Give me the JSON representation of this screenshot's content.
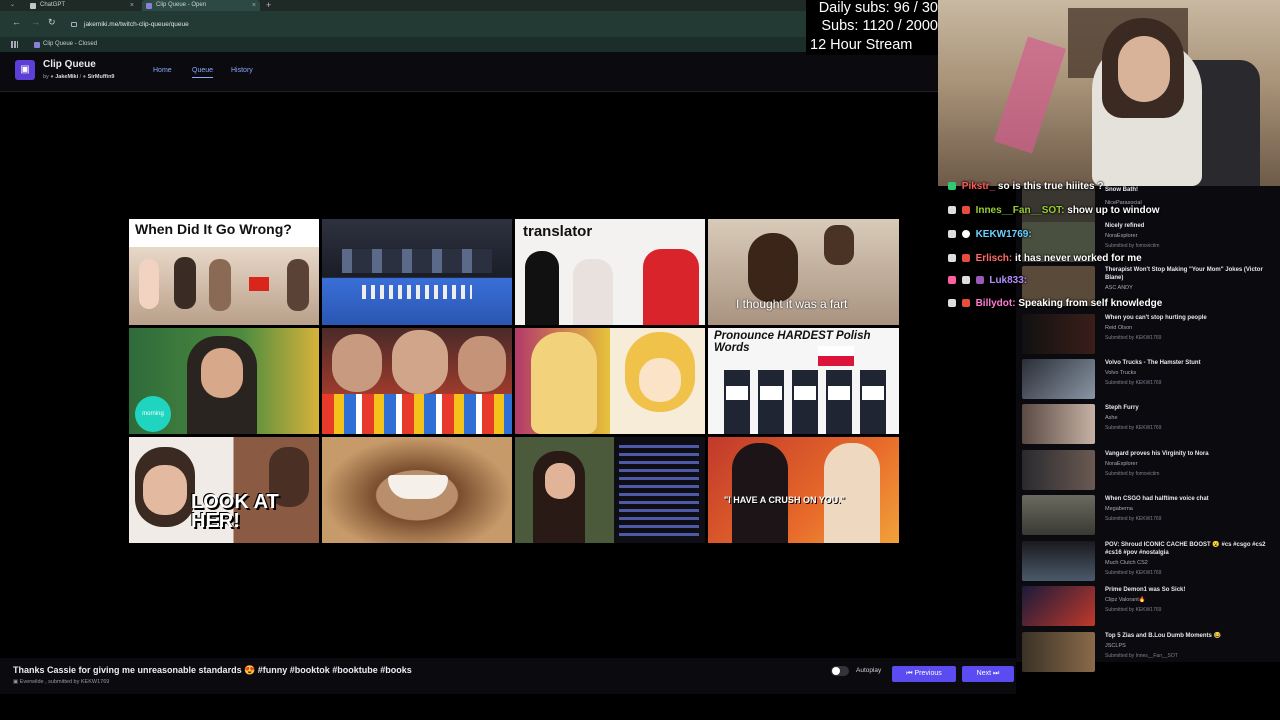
{
  "browser": {
    "menu_icon": "chevron-down-icon",
    "tabs": [
      {
        "label": "ChatGPT"
      },
      {
        "label": "Clip Queue - Open"
      }
    ],
    "url": "jakemiki.me/twitch-clip-queue/queue",
    "bookmark": "Clip Queue - Closed"
  },
  "app": {
    "title": "Clip Queue",
    "by_prefix": "by",
    "author1": "JakeMiki",
    "author2": "SirMuffin9",
    "nav": [
      "Home",
      "Queue",
      "History"
    ]
  },
  "overlay": {
    "line1": "Daily subs: 96 / 30",
    "line2": "Subs: 1120 / 2000",
    "line3": "12 Hour Stream"
  },
  "thumbs": [
    {
      "caption": "When Did It Go Wrong?"
    },
    {
      "caption": ""
    },
    {
      "caption": "translator"
    },
    {
      "caption": "I thought it was a fart"
    },
    {
      "caption": "morning"
    },
    {
      "caption": ""
    },
    {
      "caption": ""
    },
    {
      "caption": "Pronounce HARDEST Polish Words"
    },
    {
      "caption": "LOOK AT HER!"
    },
    {
      "caption": ""
    },
    {
      "caption": ""
    },
    {
      "caption": "\"I HAVE A CRUSH ON YOU.\""
    }
  ],
  "chat": [
    {
      "user": "Pikstr_",
      "text": "so is this true hiiites ?",
      "color": "#ff5a5a"
    },
    {
      "user": "Innes__Fan__SOT:",
      "text": "show up to window",
      "color": "#9acd32"
    },
    {
      "user": "KEKW1769:",
      "text": "",
      "color": "#6ad1ff"
    },
    {
      "user": "Erlisch:",
      "text": "it has never worked for me",
      "color": "#ff6b6b"
    },
    {
      "user": "Luk833:",
      "text": "",
      "color": "#b48cff"
    },
    {
      "user": "Billydot:",
      "text": "Speaking from self knowledge",
      "color": "#ff7bd0"
    }
  ],
  "queue": [
    {
      "title": "Snow Bath!",
      "channel": "NiceParasocial",
      "submitted": ""
    },
    {
      "title": "Nicely refined",
      "channel": "NoraExplorer",
      "submitted": "Submitted by fomovictim"
    },
    {
      "title": "Therapist Won't Stop Making \"Your Mom\" Jokes (Victor Blane)",
      "channel": "ASC ANDY",
      "submitted": ""
    },
    {
      "title": "When you can't stop hurting people",
      "channel": "Reid Olson",
      "submitted": "Submitted by KEKW1769"
    },
    {
      "title": "Volvo Trucks - The Hamster Stunt",
      "channel": "Volvo Trucks",
      "submitted": "Submitted by KEKW1769"
    },
    {
      "title": "Steph Furry",
      "channel": "Ashe",
      "submitted": "Submitted by KEKW1769"
    },
    {
      "title": "Vangard proves his Virginity to Nora",
      "channel": "NoraExplorer",
      "submitted": "Submitted by fomovictim"
    },
    {
      "title": "When CSGO had halftime voice chat",
      "channel": "Megaberna",
      "submitted": "Submitted by KEKW1769"
    },
    {
      "title": "POV: Shroud ICONIC CACHE BOOST 😮 #cs #csgo #cs2 #cs16 #pov #nostalgia",
      "channel": "Much Clutch CS2",
      "submitted": "Submitted by KEKW1769"
    },
    {
      "title": "Prime Demon1 was So Sick!",
      "channel": "Clipz Valorant🔥",
      "submitted": "Submitted by KEKW1769"
    },
    {
      "title": "Top 5 Zias and B.Lou Dumb Moments 😂",
      "channel": "JSCLPS",
      "submitted": "Submitted by Innes__Fan__SOT"
    }
  ],
  "current": {
    "title": "Thanks Cassie for giving me unreasonable standards 😍 #funny #booktok #booktube #books",
    "channel": "Everwilde",
    "submitted_by": "submitted by KEKW1769"
  },
  "controls": {
    "autoplay_label": "Autoplay",
    "autoplay_on": false,
    "previous_label": "Previous",
    "next_label": "Next"
  },
  "colors": {
    "accent": "#5a4cf0",
    "nav_link": "#8ea6ff",
    "background": "#0b0b0f"
  }
}
